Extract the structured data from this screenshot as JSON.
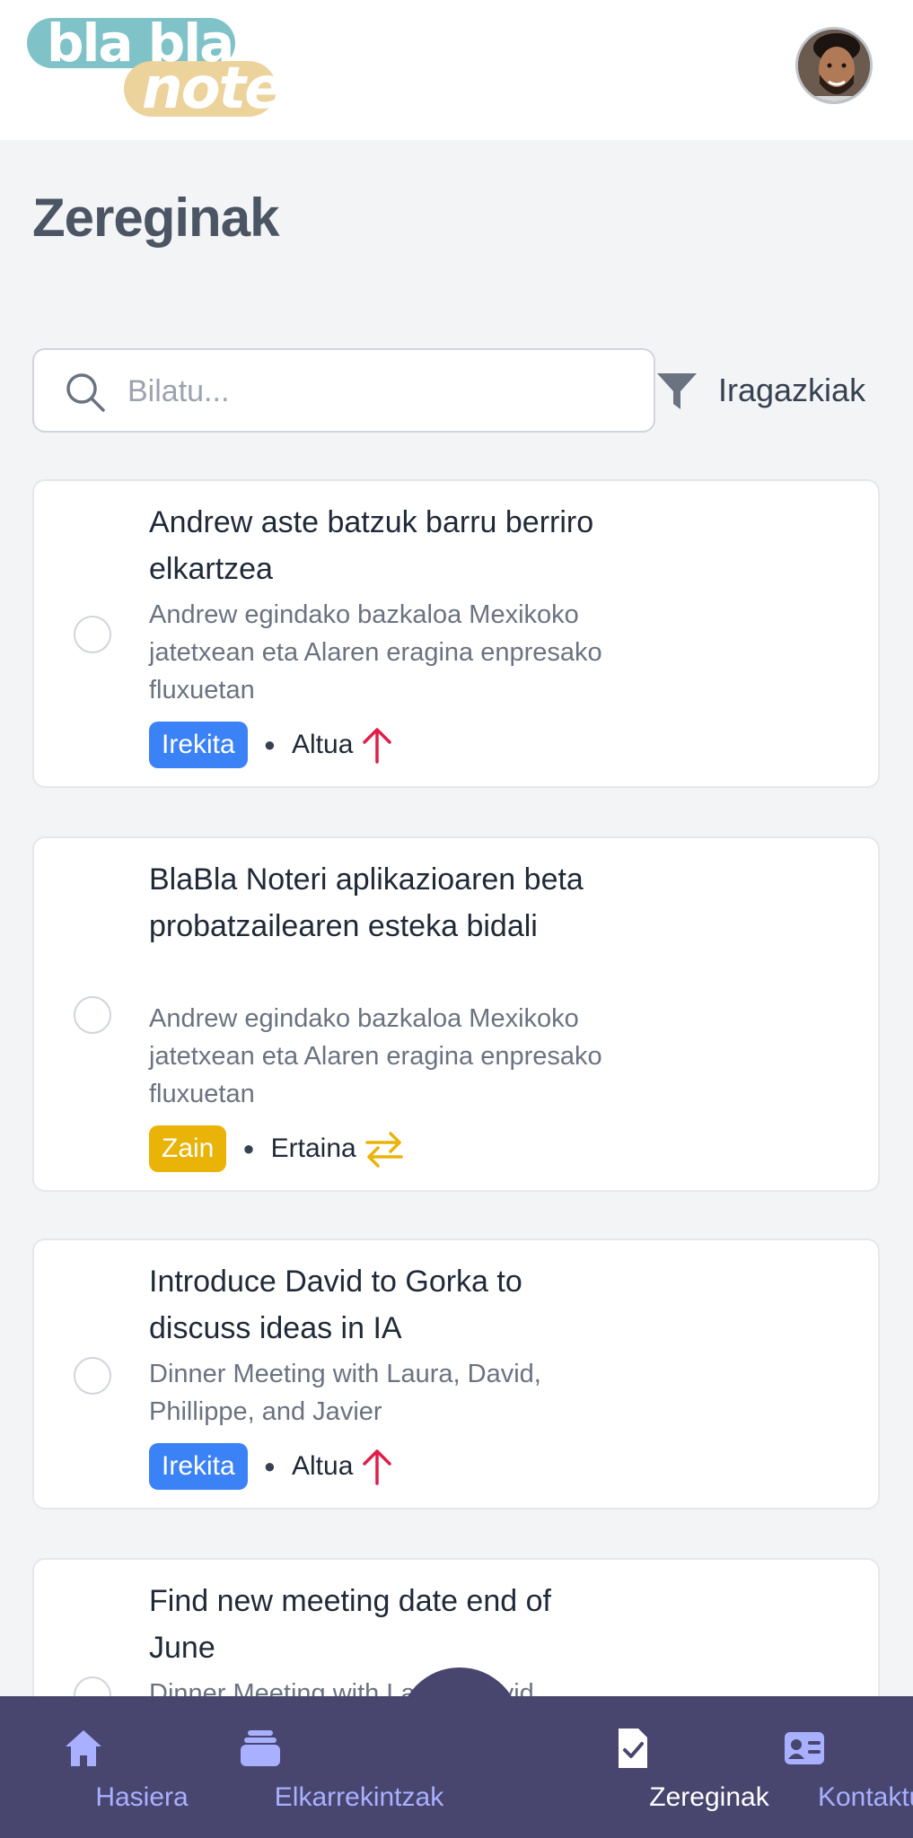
{
  "app": {
    "logo_line1": "bla bla",
    "logo_line2": "note"
  },
  "page": {
    "title": "Zereginak"
  },
  "search": {
    "placeholder": "Bilatu...",
    "value": ""
  },
  "filter": {
    "label": "Iragazkiak"
  },
  "tasks": [
    {
      "title": "Andrew aste batzuk barru berriro elkartzea",
      "description": "Andrew egindako bazkaloa Mexikoko jatetxean eta Alaren eragina enpresako fluxuetan",
      "status": "Irekita",
      "priority": "Altua",
      "priority_icon": "arrow-up-icon"
    },
    {
      "title": "BlaBla Noteri aplikazioaren beta probatzailearen esteka bidali",
      "description": "Andrew egindako bazkaloa Mexikoko jatetxean eta Alaren eragina enpresako fluxuetan",
      "status": "Zain",
      "priority": "Ertaina",
      "priority_icon": "arrows-swap-icon"
    },
    {
      "title": "Introduce David to Gorka to discuss ideas in IA",
      "description": "Dinner Meeting with Laura, David, Phillippe, and Javier",
      "status": "Irekita",
      "priority": "Altua",
      "priority_icon": "arrow-up-icon"
    },
    {
      "title": "Find new meeting date end of June",
      "description": "Dinner Meeting with Laura, David,"
    }
  ],
  "nav": {
    "items": [
      {
        "label": "Hasiera",
        "icon": "home-icon"
      },
      {
        "label": "Elkarrekintzak",
        "icon": "stack-icon"
      },
      {
        "label": "Zereginak",
        "icon": "task-icon"
      },
      {
        "label": "Kontaktuak",
        "icon": "contact-card-icon"
      }
    ],
    "active": "Zereginak",
    "mic_icon": "microphone-icon"
  },
  "colors": {
    "primary_blue": "#3b82f6",
    "warning_yellow": "#eab308",
    "priority_high": "#e11d48",
    "nav_background": "#48456f",
    "nav_inactive": "#a9b0ff"
  }
}
